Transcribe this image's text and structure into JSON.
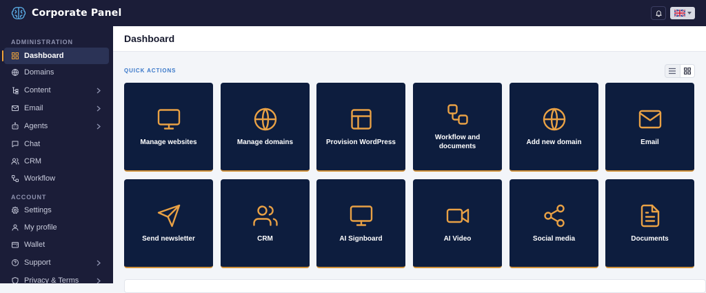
{
  "app": {
    "title": "Corporate Panel"
  },
  "colors": {
    "accent": "#f2a63b",
    "sidebar_bg": "#1b1d38",
    "card_bg": "#0d1d3e",
    "link_label": "#3a78c9"
  },
  "topbar": {
    "notifications_icon": "bell-icon",
    "language_icon": "uk-flag-icon"
  },
  "sidebar": {
    "sections": [
      {
        "label": "ADMINISTRATION",
        "items": [
          {
            "label": "Dashboard",
            "icon": "dashboard-icon",
            "active": true
          },
          {
            "label": "Domains",
            "icon": "globe-icon"
          },
          {
            "label": "Content",
            "icon": "content-icon",
            "submenu": true
          },
          {
            "label": "Email",
            "icon": "mail-icon",
            "submenu": true
          },
          {
            "label": "Agents",
            "icon": "robot-icon",
            "submenu": true
          },
          {
            "label": "Chat",
            "icon": "chat-icon"
          },
          {
            "label": "CRM",
            "icon": "users-icon"
          },
          {
            "label": "Workflow",
            "icon": "workflow-icon"
          }
        ]
      },
      {
        "label": "ACCOUNT",
        "items": [
          {
            "label": "Settings",
            "icon": "gear-icon"
          },
          {
            "label": "My profile",
            "icon": "user-icon"
          },
          {
            "label": "Wallet",
            "icon": "wallet-icon"
          },
          {
            "label": "Support",
            "icon": "help-icon",
            "submenu": true
          },
          {
            "label": "Privacy & Terms",
            "icon": "shield-icon",
            "submenu": true
          }
        ]
      }
    ]
  },
  "main": {
    "title": "Dashboard",
    "quick_actions_label": "QUICK ACTIONS",
    "view_toggle": {
      "options": [
        "list-view-icon",
        "grid-view-icon"
      ],
      "selected": "grid"
    },
    "cards": [
      {
        "label": "Manage websites",
        "icon": "monitor-icon"
      },
      {
        "label": "Manage domains",
        "icon": "globe-icon"
      },
      {
        "label": "Provision WordPress",
        "icon": "layout-icon"
      },
      {
        "label": "Workflow and documents",
        "icon": "workflow-icon"
      },
      {
        "label": "Add new domain",
        "icon": "globe-icon"
      },
      {
        "label": "Email",
        "icon": "mail-icon"
      },
      {
        "label": "Send newsletter",
        "icon": "send-icon"
      },
      {
        "label": "CRM",
        "icon": "users-icon"
      },
      {
        "label": "AI Signboard",
        "icon": "monitor-icon"
      },
      {
        "label": "AI Video",
        "icon": "video-icon"
      },
      {
        "label": "Social media",
        "icon": "share-icon"
      },
      {
        "label": "Documents",
        "icon": "document-icon"
      }
    ]
  }
}
